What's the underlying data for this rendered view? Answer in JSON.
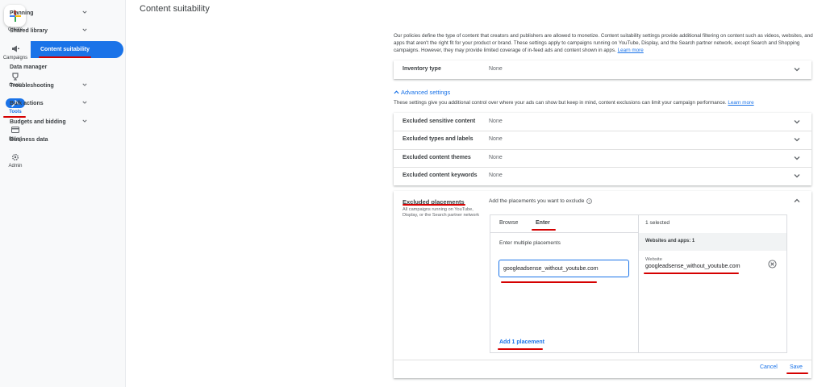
{
  "rail": {
    "create_label": "Create",
    "items": [
      {
        "label": "Campaigns",
        "icon": "megaphone-icon"
      },
      {
        "label": "Goals",
        "icon": "trophy-icon"
      },
      {
        "label": "Tools",
        "icon": "wrench-icon",
        "active": true
      },
      {
        "label": "Billing",
        "icon": "card-icon"
      },
      {
        "label": "Admin",
        "icon": "gear-icon"
      }
    ]
  },
  "subnav": {
    "items": [
      {
        "label": "Planning",
        "expandable": true
      },
      {
        "label": "Shared library",
        "expandable": true
      },
      {
        "label": "Content suitability",
        "active": true
      },
      {
        "label": "Data manager"
      },
      {
        "label": "Troubleshooting",
        "expandable": true
      },
      {
        "label": "Bulk actions",
        "expandable": true
      },
      {
        "label": "Budgets and bidding",
        "expandable": true
      },
      {
        "label": "Business data"
      }
    ]
  },
  "page": {
    "title": "Content suitability",
    "description": "Our policies define the type of content that creators and publishers are allowed to monetize. Content suitability settings provide additional filtering on content such as videos, websites, and apps that aren't the right fit for your product or brand. These settings apply to campaigns running on YouTube, Display, and the Search partner network, except Search and Shopping campaigns. However, they may provide limited coverage of in-feed ads and content shown in apps.",
    "learn_more": "Learn more"
  },
  "inventory": {
    "label": "Inventory type",
    "value": "None"
  },
  "advanced": {
    "label": "Advanced settings",
    "description": "These settings give you additional control over where your ads can show but keep in mind, content exclusions can limit your campaign performance.",
    "learn_more": "Learn more",
    "rows": [
      {
        "label": "Excluded sensitive content",
        "value": "None"
      },
      {
        "label": "Excluded types and labels",
        "value": "None"
      },
      {
        "label": "Excluded content themes",
        "value": "None"
      },
      {
        "label": "Excluded content keywords",
        "value": "None"
      }
    ]
  },
  "placements": {
    "title": "Excluded placements",
    "subtitle": "All campaigns running on YouTube, Display, or the Search partner network",
    "instruction": "Add the placements you want to exclude",
    "tabs": [
      "Browse",
      "Enter"
    ],
    "active_tab": "Enter",
    "enter_hint": "Enter multiple placements",
    "input_value": "googleadsense_without_youtube.com",
    "add_button": "Add 1 placement",
    "selected_count": "1 selected",
    "group_header": "Websites and apps: 1",
    "selected_item": {
      "type": "Website",
      "value": "googleadsense_without_youtube.com"
    }
  },
  "footer": {
    "cancel": "Cancel",
    "save": "Save"
  },
  "colors": {
    "accent": "#1a73e8",
    "annotation": "#d50000"
  }
}
